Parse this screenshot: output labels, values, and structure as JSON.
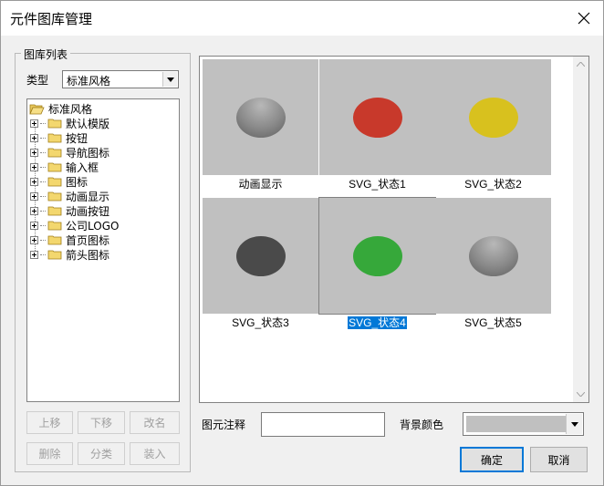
{
  "window": {
    "title": "元件图库管理"
  },
  "left_panel": {
    "group_title": "图库列表",
    "type_label": "类型",
    "type_value": "标准风格",
    "tree": {
      "root": "标准风格",
      "children": [
        "默认模版",
        "按钮",
        "导航图标",
        "输入框",
        "图标",
        "动画显示",
        "动画按钮",
        "公司LOGO",
        "首页图标",
        "箭头图标"
      ]
    },
    "buttons": {
      "move_up": "上移",
      "move_down": "下移",
      "rename": "改名",
      "delete": "删除",
      "categorize": "分类",
      "load": "装入"
    }
  },
  "gallery": {
    "items": [
      {
        "caption": "动画显示",
        "color": "gradient-gray"
      },
      {
        "caption": "SVG_状态1",
        "color": "#c8392b"
      },
      {
        "caption": "SVG_状态2",
        "color": "#d8c11e"
      },
      {
        "caption": "SVG_状态3",
        "color": "#4a4a4a"
      },
      {
        "caption": "SVG_状态4",
        "color": "#36a83a",
        "selected": true
      },
      {
        "caption": "SVG_状态5",
        "color": "gradient-gray"
      }
    ]
  },
  "bottom": {
    "note_label": "图元注释",
    "note_value": "",
    "bg_color_label": "背景颜色",
    "bg_color_value": "#c0c0c0",
    "ok_label": "确定",
    "cancel_label": "取消"
  }
}
